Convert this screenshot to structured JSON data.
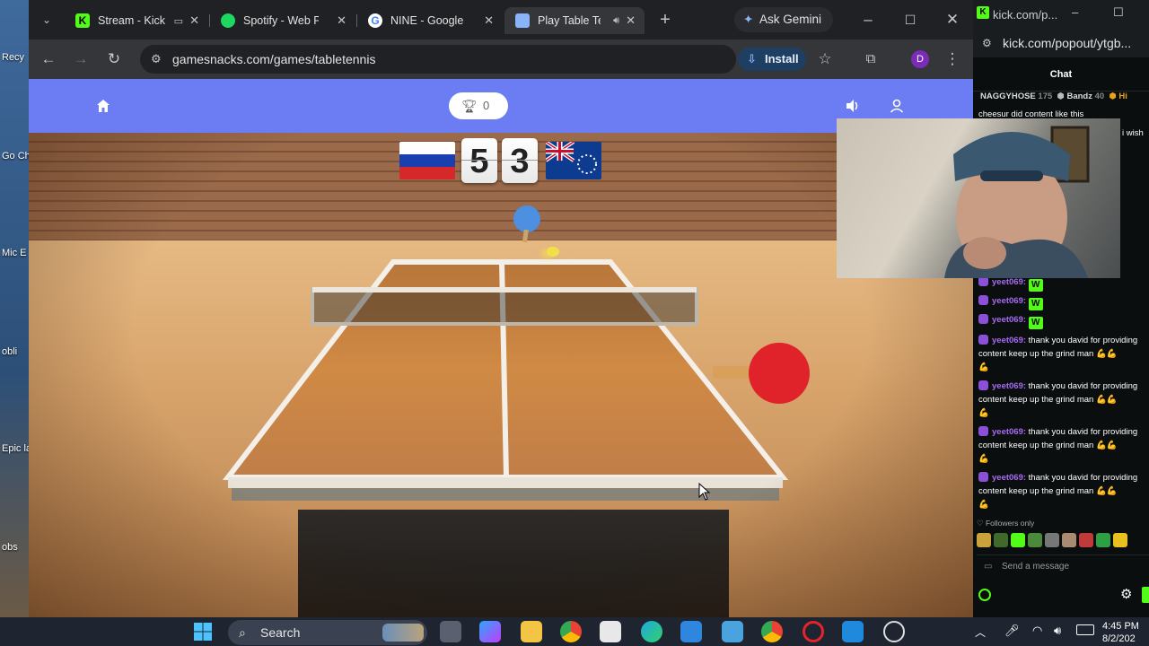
{
  "desktop": {
    "icons": [
      "Recy",
      "Go Ch",
      "Mic E",
      "obli",
      "Epic lau",
      "obs"
    ]
  },
  "browser": {
    "tabs": [
      {
        "title": "Stream - Kick",
        "active": false
      },
      {
        "title": "Spotify - Web Pl",
        "active": false
      },
      {
        "title": "NINE - Google S",
        "active": false
      },
      {
        "title": "Play Table Te",
        "active": true
      }
    ],
    "ask_gemini": "Ask Gemini",
    "url": "gamesnacks.com/games/tabletennis",
    "install_label": "Install",
    "profile_initial": "D"
  },
  "game": {
    "trophy_count": "0",
    "score_left": "5",
    "score_right": "3",
    "colors": {
      "header": "#6c7cf2",
      "table": "#c97a2c",
      "paddle_red": "#e0222a",
      "paddle_blue": "#4d8fe0"
    }
  },
  "chat_window": {
    "title": "kick.com/p...",
    "url": "kick.com/popout/ytgb...",
    "header": "Chat",
    "leaderboard": [
      {
        "name": "NAGGYHOSE",
        "count": "175"
      },
      {
        "name": "Bandz",
        "count": "40"
      },
      {
        "name": "Hi",
        "count": ""
      }
    ],
    "messages": [
      {
        "user": "",
        "text": "cheesur did content like this"
      },
      {
        "user": "",
        "text": "i wish"
      },
      {
        "user": "yeet069:",
        "text": "W"
      },
      {
        "user": "yeet069:",
        "text": "W"
      },
      {
        "user": "yeet069:",
        "text": "W"
      },
      {
        "user": "yeet069:",
        "text": "thank you david for providing",
        "cont": "content keep up the grind man"
      },
      {
        "user": "yeet069:",
        "text": "thank you david for providing",
        "cont": "content keep up the grind man"
      },
      {
        "user": "yeet069:",
        "text": "thank you david for providing",
        "cont": "content keep up the grind man"
      },
      {
        "user": "yeet069:",
        "text": "thank you david for providing",
        "cont": "content keep up the grind man"
      }
    ],
    "followers_only": "Followers only",
    "send_placeholder": "Send a message"
  },
  "taskbar": {
    "search_label": "Search",
    "time": "4:45 PM",
    "date": "8/2/202"
  }
}
